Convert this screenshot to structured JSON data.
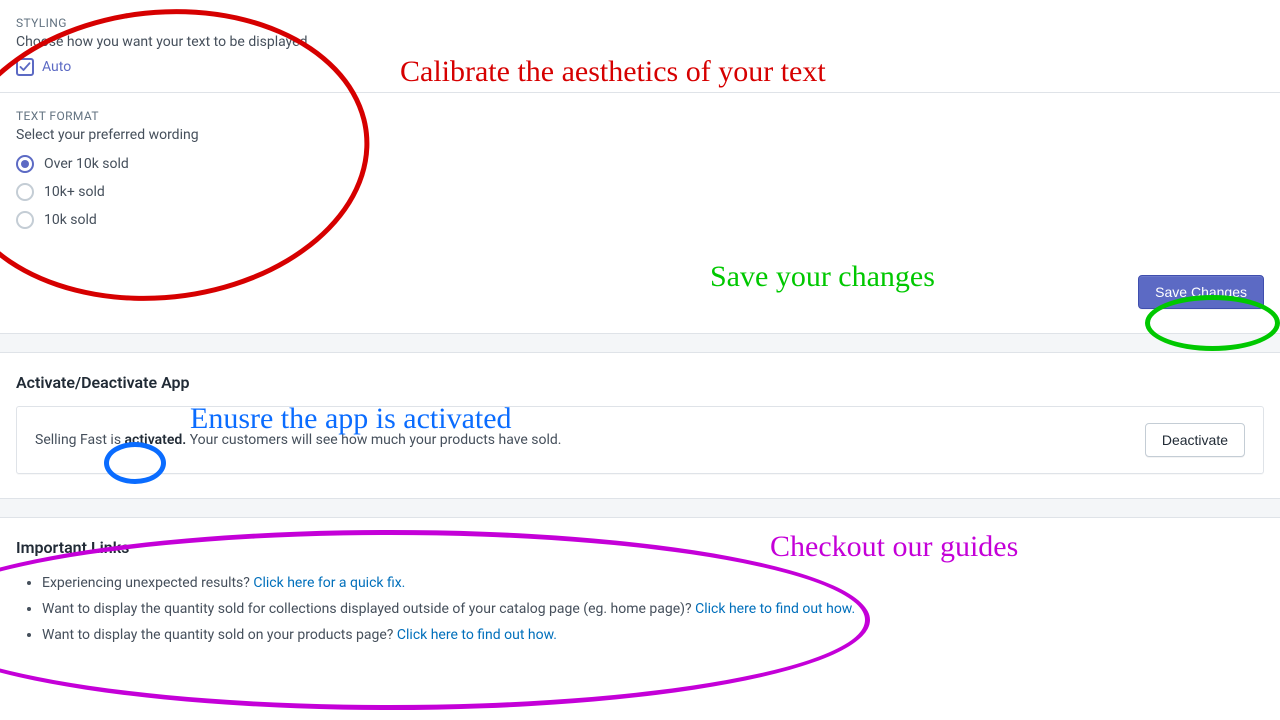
{
  "styling": {
    "label": "STYLING",
    "description": "Choose how you want your text to be displayed",
    "auto_label": "Auto",
    "auto_checked": true
  },
  "text_format": {
    "label": "TEXT FORMAT",
    "description": "Select your preferred wording",
    "options": [
      {
        "label": "Over 10k sold",
        "selected": true
      },
      {
        "label": "10k+ sold",
        "selected": false
      },
      {
        "label": "10k sold",
        "selected": false
      }
    ]
  },
  "save_button": "Save Changes",
  "activate": {
    "heading": "Activate/Deactivate App",
    "prefix": "Selling Fast is ",
    "status_word": "activated.",
    "suffix": " Your customers will see how much your products have sold.",
    "button": "Deactivate"
  },
  "important_links": {
    "heading": "Important Links",
    "items": [
      {
        "text": "Experiencing unexpected results? ",
        "link": "Click here for a quick fix."
      },
      {
        "text": "Want to display the quantity sold for collections displayed outside of your catalog page (eg. home page)? ",
        "link": "Click here to find out how."
      },
      {
        "text": "Want to display the quantity sold on your products page? ",
        "link": "Click here to find out how."
      }
    ]
  },
  "annotations": {
    "calibrate": "Calibrate the aesthetics of your text",
    "save": "Save your changes",
    "activate": "Enusre the app is activated",
    "guides": "Checkout our guides"
  }
}
